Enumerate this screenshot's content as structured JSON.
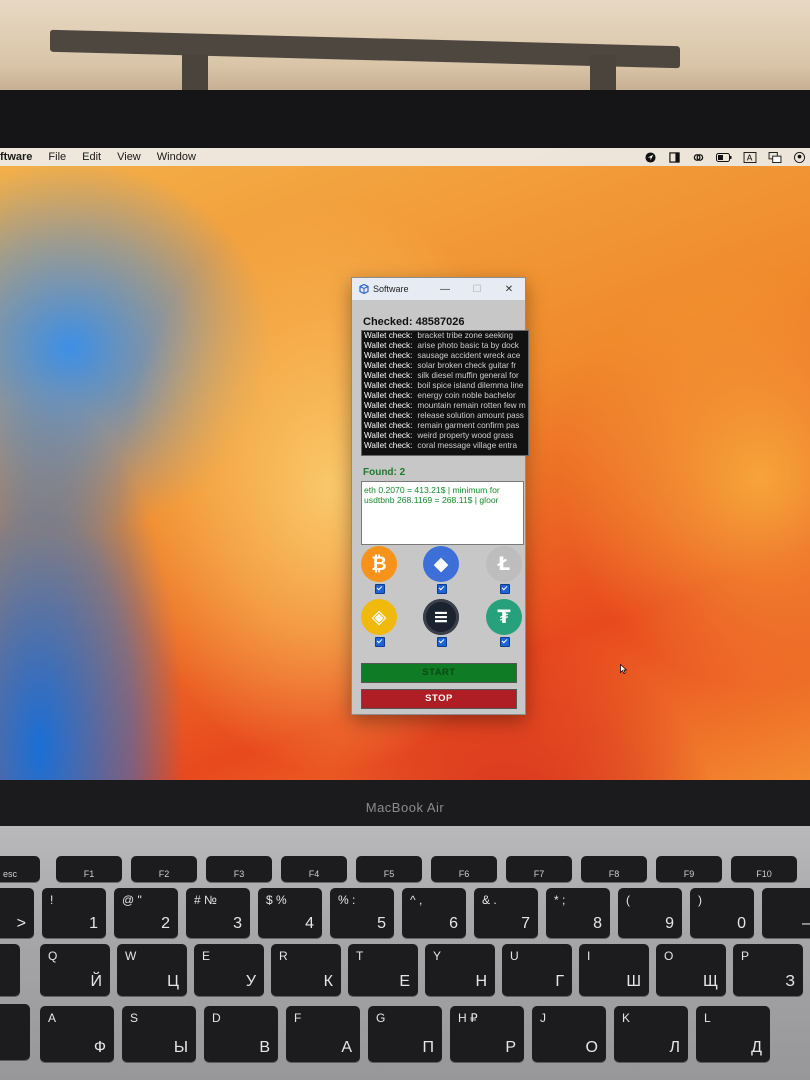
{
  "macos": {
    "menu": [
      "ftware",
      "File",
      "Edit",
      "View",
      "Window"
    ],
    "status_icons": [
      "navigation-icon",
      "window-icon",
      "creative-cloud-icon",
      "battery-icon",
      "keyboard-input-icon",
      "screen-mirroring-icon",
      "user-icon"
    ]
  },
  "window": {
    "title": "Software",
    "minimize": "—",
    "maximize": "☐",
    "close": "✕"
  },
  "checked": {
    "text": "Checked: 48587026"
  },
  "log": {
    "rows": [
      {
        "label": "Wallet check:",
        "value": "bracket tribe zone seeking"
      },
      {
        "label": "Wallet check:",
        "value": "arise photo basic ta by dock"
      },
      {
        "label": "Wallet check:",
        "value": "sausage accident wreck ace"
      },
      {
        "label": "Wallet check:",
        "value": "solar broken check guitar fr"
      },
      {
        "label": "Wallet check:",
        "value": "silk diesel muffin general for"
      },
      {
        "label": "Wallet check:",
        "value": "boil spice island dilemma line"
      },
      {
        "label": "Wallet check:",
        "value": "energy coin noble bachelor"
      },
      {
        "label": "Wallet check:",
        "value": "mountain remain rotten few m"
      },
      {
        "label": "Wallet check:",
        "value": "release solution amount pass"
      },
      {
        "label": "Wallet check:",
        "value": "remain garment confirm pas"
      },
      {
        "label": "Wallet check:",
        "value": "weird property wood grass"
      },
      {
        "label": "Wallet check:",
        "value": "coral message village entra"
      }
    ]
  },
  "found": {
    "label": "Found: 2",
    "rows": [
      "eth 0.2070 = 413.21$ | minimum for",
      "usdtbnb 268.1169 = 268.11$ | gloor"
    ]
  },
  "coins": [
    {
      "name": "bitcoin",
      "glyph": "₿",
      "color": "#f7931a",
      "checked": true
    },
    {
      "name": "ethereum",
      "glyph": "◆",
      "color": "#3c6fd8",
      "checked": true
    },
    {
      "name": "litecoin",
      "glyph": "Ł",
      "color": "#bdbdbd",
      "checked": true
    },
    {
      "name": "bnb",
      "glyph": "◈",
      "color": "#f0b90b",
      "checked": true
    },
    {
      "name": "solana",
      "glyph": "≡",
      "color": "#1b2330",
      "checked": true
    },
    {
      "name": "tether",
      "glyph": "₮",
      "color": "#26a17b",
      "checked": true
    }
  ],
  "buttons": {
    "start": "START",
    "stop": "STOP"
  },
  "device": {
    "brand": "MacBook Air"
  },
  "keyboard": {
    "fn_row": [
      "esc",
      "F1",
      "F2",
      "F3",
      "F4",
      "F5",
      "F6",
      "F7",
      "F8",
      "F9",
      "F10"
    ],
    "num_row": [
      {
        "t": "<",
        "b": ">"
      },
      {
        "t": "!",
        "b": "1"
      },
      {
        "t": "@ \"",
        "b": "2"
      },
      {
        "t": "# №",
        "b": "3"
      },
      {
        "t": "$ %",
        "b": "4"
      },
      {
        "t": "% :",
        "b": "5"
      },
      {
        "t": "^ ,",
        "b": "6"
      },
      {
        "t": "& .",
        "b": "7"
      },
      {
        "t": "* ;",
        "b": "8"
      },
      {
        "t": "(",
        "b": "9"
      },
      {
        "t": ")",
        "b": "0"
      },
      {
        "t": "",
        "b": "—"
      }
    ],
    "q_row": [
      {
        "t": "Q",
        "b": "Й"
      },
      {
        "t": "W",
        "b": "Ц"
      },
      {
        "t": "E",
        "b": "У"
      },
      {
        "t": "R",
        "b": "К"
      },
      {
        "t": "T",
        "b": "Е"
      },
      {
        "t": "Y",
        "b": "Н"
      },
      {
        "t": "U",
        "b": "Г"
      },
      {
        "t": "I",
        "b": "Ш"
      },
      {
        "t": "O",
        "b": "Щ"
      },
      {
        "t": "P",
        "b": "З"
      }
    ],
    "a_row": [
      {
        "t": "A",
        "b": "Ф"
      },
      {
        "t": "S",
        "b": "Ы"
      },
      {
        "t": "D",
        "b": "В"
      },
      {
        "t": "F",
        "b": "А"
      },
      {
        "t": "G",
        "b": "П"
      },
      {
        "t": "H ₽",
        "b": "Р"
      },
      {
        "t": "J",
        "b": "О"
      },
      {
        "t": "K",
        "b": "Л"
      },
      {
        "t": "L",
        "b": "Д"
      }
    ]
  }
}
